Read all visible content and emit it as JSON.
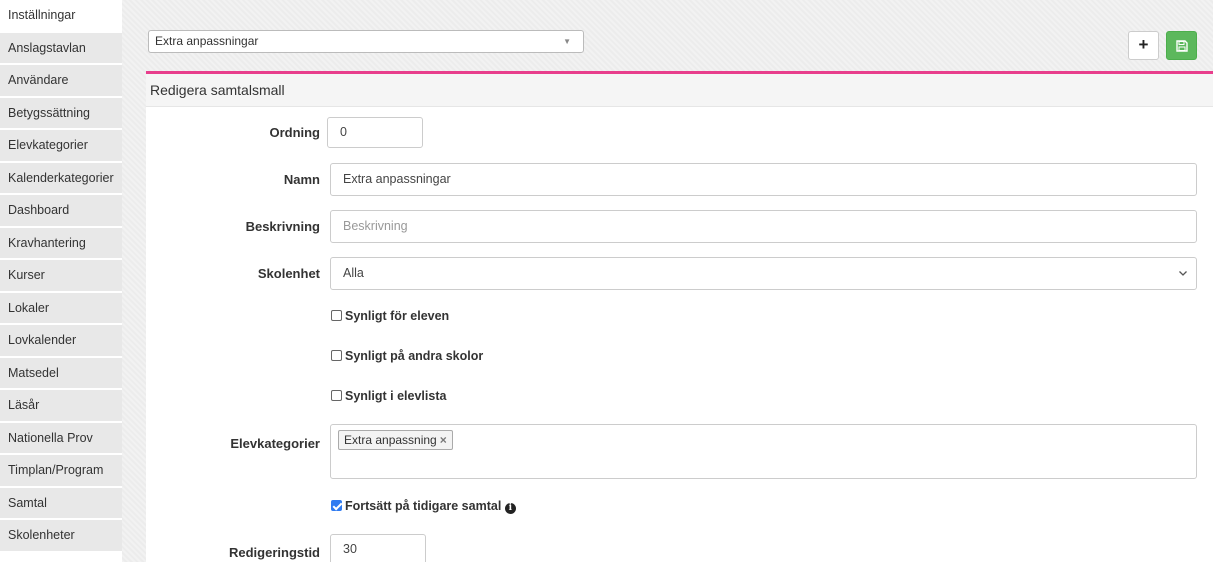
{
  "sidebar": {
    "items": [
      {
        "label": "Inställningar"
      },
      {
        "label": "Anslagstavlan"
      },
      {
        "label": "Användare"
      },
      {
        "label": "Betygssättning"
      },
      {
        "label": "Elevkategorier"
      },
      {
        "label": "Kalenderkategorier"
      },
      {
        "label": "Dashboard"
      },
      {
        "label": "Kravhantering"
      },
      {
        "label": "Kurser"
      },
      {
        "label": "Lokaler"
      },
      {
        "label": "Lovkalender"
      },
      {
        "label": "Matsedel"
      },
      {
        "label": "Läsår"
      },
      {
        "label": "Nationella Prov"
      },
      {
        "label": "Timplan/Program"
      },
      {
        "label": "Samtal"
      },
      {
        "label": "Skolenheter"
      }
    ]
  },
  "toolbar": {
    "template_select_value": "Extra anpassningar",
    "add_label": "+",
    "save_icon": "floppy-disk-icon"
  },
  "panel": {
    "title": "Redigera samtalsmall"
  },
  "form": {
    "ordning_label": "Ordning",
    "ordning_value": "0",
    "namn_label": "Namn",
    "namn_value": "Extra anpassningar",
    "beskrivning_label": "Beskrivning",
    "beskrivning_placeholder": "Beskrivning",
    "skolenhet_label": "Skolenhet",
    "skolenhet_value": "Alla",
    "synligt_eleven_label": "Synligt för eleven",
    "synligt_eleven_checked": false,
    "synligt_andra_label": "Synligt på andra skolor",
    "synligt_andra_checked": false,
    "synligt_elevlista_label": "Synligt i elevlista",
    "synligt_elevlista_checked": false,
    "elevkategorier_label": "Elevkategorier",
    "elevkategorier_tags": [
      "Extra anpassning"
    ],
    "tag_remove_glyph": "×",
    "fortsatt_label": "Fortsätt på tidigare samtal",
    "fortsatt_checked": true,
    "info_glyph": "i",
    "redigeringstid_label": "Redigeringstid",
    "redigeringstid_value": "30"
  },
  "colors": {
    "accent_pink": "#e83e8c",
    "save_green": "#5cb85c",
    "checkbox_blue": "#2f7bf1"
  }
}
